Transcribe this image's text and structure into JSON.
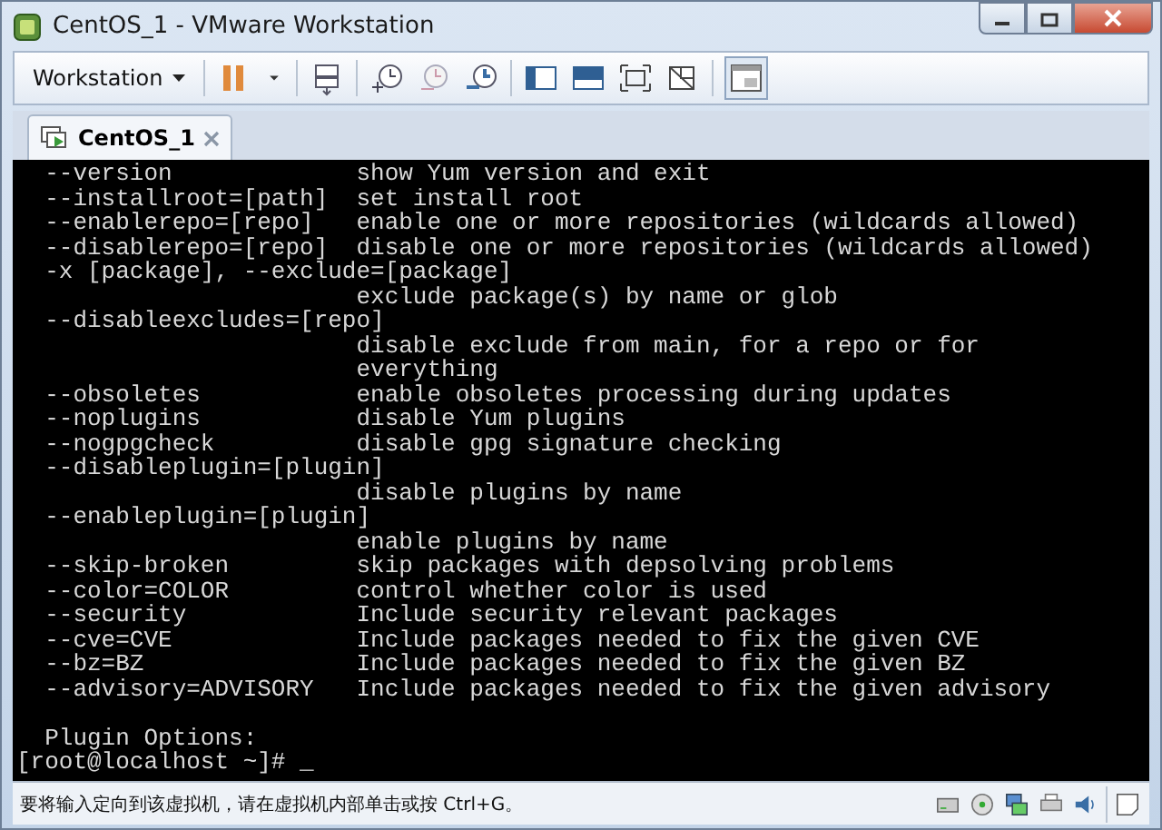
{
  "window": {
    "title": "CentOS_1 - VMware Workstation"
  },
  "toolbar": {
    "menu": "Workstation"
  },
  "tabs": [
    {
      "label": "CentOS_1",
      "selected": true
    }
  ],
  "terminal": {
    "output_lines": [
      "  --version             show Yum version and exit",
      "  --installroot=[path]  set install root",
      "  --enablerepo=[repo]   enable one or more repositories (wildcards allowed)",
      "  --disablerepo=[repo]  disable one or more repositories (wildcards allowed)",
      "  -x [package], --exclude=[package]",
      "                        exclude package(s) by name or glob",
      "  --disableexcludes=[repo]",
      "                        disable exclude from main, for a repo or for",
      "                        everything",
      "  --obsoletes           enable obsoletes processing during updates",
      "  --noplugins           disable Yum plugins",
      "  --nogpgcheck          disable gpg signature checking",
      "  --disableplugin=[plugin]",
      "                        disable plugins by name",
      "  --enableplugin=[plugin]",
      "                        enable plugins by name",
      "  --skip-broken         skip packages with depsolving problems",
      "  --color=COLOR         control whether color is used",
      "  --security            Include security relevant packages",
      "  --cve=CVE             Include packages needed to fix the given CVE",
      "  --bz=BZ               Include packages needed to fix the given BZ",
      "  --advisory=ADVISORY   Include packages needed to fix the given advisory"
    ],
    "section_header": "  Plugin Options:",
    "prompt": "[root@localhost ~]# _"
  },
  "status_bar": {
    "text": "要将输入定向到该虚拟机，请在虚拟机内部单击或按 Ctrl+G。"
  }
}
